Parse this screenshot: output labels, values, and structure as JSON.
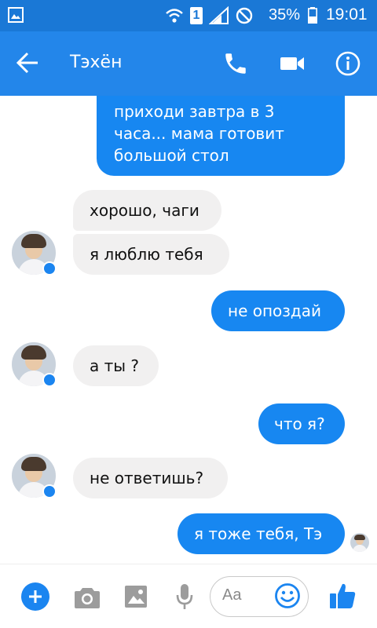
{
  "status_bar": {
    "sim_slot": "1",
    "battery_percent": "35%",
    "time": "19:01"
  },
  "toolbar": {
    "back_icon": "arrow-left-icon",
    "title": "Тэхён",
    "call_icon": "phone-icon",
    "video_icon": "video-camera-icon",
    "info_icon": "info-icon"
  },
  "colors": {
    "status_bar": "#1a78d6",
    "toolbar": "#2386ea",
    "outgoing_bubble": "#1787f1",
    "incoming_bubble": "#f1f0f0",
    "accent": "#1b85f0"
  },
  "messages": [
    {
      "direction": "outgoing",
      "lines": [
        "приходи завтра в 3",
        "часа... мама готовит",
        "большой стол"
      ]
    },
    {
      "direction": "incoming",
      "text": "хорошо, чаги"
    },
    {
      "direction": "incoming",
      "text": "я люблю тебя"
    },
    {
      "direction": "outgoing",
      "text": "не опоздай"
    },
    {
      "direction": "incoming",
      "text": "а ты ?"
    },
    {
      "direction": "outgoing",
      "text": "что я?"
    },
    {
      "direction": "incoming",
      "text": "не ответишь?"
    },
    {
      "direction": "outgoing",
      "text": "я тоже тебя, Тэ"
    }
  ],
  "composer": {
    "placeholder": "Aa",
    "plus_icon": "plus-icon",
    "camera_icon": "camera-icon",
    "image_icon": "image-icon",
    "mic_icon": "microphone-icon",
    "emoji_icon": "smiley-icon",
    "like_icon": "thumbs-up-icon"
  }
}
